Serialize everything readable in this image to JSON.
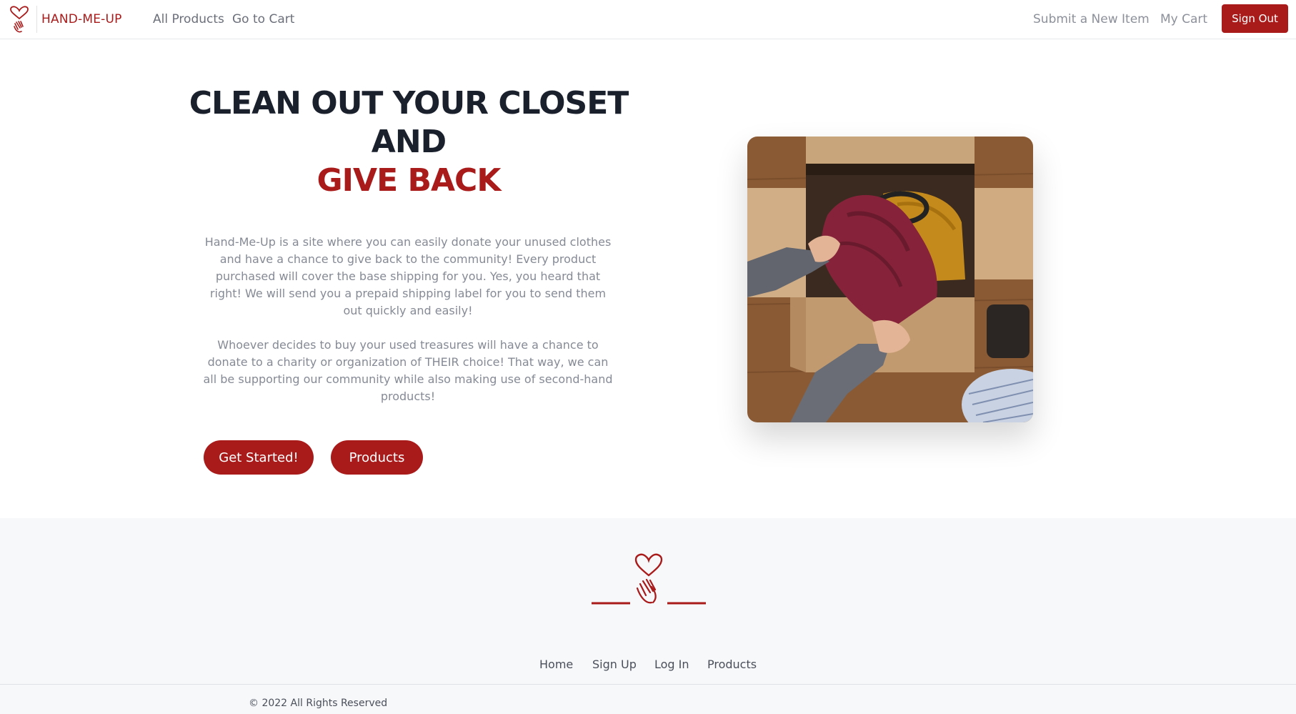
{
  "navbar": {
    "brand_name": "HAND-ME-UP",
    "logo_icon": "heart-hand-icon",
    "links": {
      "all_products": "All Products",
      "go_to_cart": "Go to Cart",
      "submit_item": "Submit a New Item",
      "my_cart": "My Cart"
    },
    "sign_out": "Sign Out"
  },
  "hero": {
    "heading_line1": "CLEAN OUT YOUR CLOSET",
    "heading_line2": "AND",
    "heading_accent": "GIVE BACK",
    "paragraph1": "Hand-Me-Up is a site where you can easily donate your unused clothes and have a chance to give back to the community! Every product purchased will cover the base shipping for you. Yes, you heard that right! We will send you a prepaid shipping label for you to send them out quickly and easily!",
    "paragraph2": "Whoever decides to buy your used treasures will have a chance to donate to a charity or organization of THEIR choice! That way, we can all be supporting our community while also making use of second-hand products!",
    "get_started": "Get Started!",
    "products": "Products",
    "image_icon": "donation-box-photo"
  },
  "footer": {
    "logo_icon": "heart-hand-icon",
    "links": {
      "home": "Home",
      "sign_up": "Sign Up",
      "log_in": "Log In",
      "products": "Products"
    },
    "copyright": "© 2022 All Rights Reserved"
  },
  "colors": {
    "brand": "#a91b1b",
    "heading": "#1a202c",
    "muted_text": "#858a95",
    "footer_bg": "#f7f8fa"
  }
}
